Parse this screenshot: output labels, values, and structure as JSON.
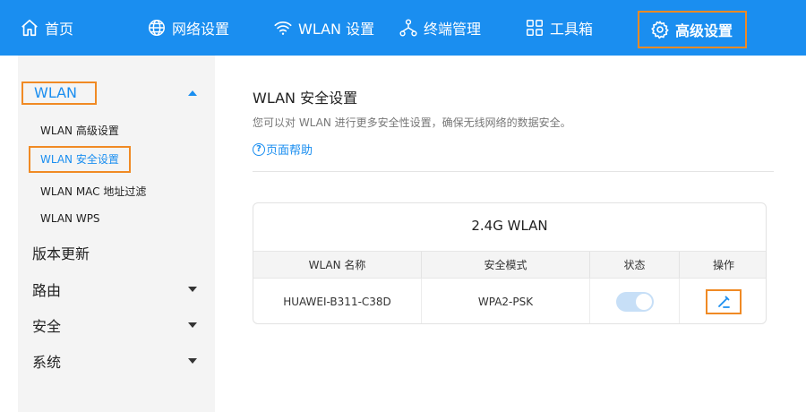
{
  "nav": {
    "home": "首页",
    "network": "网络设置",
    "wlan": "WLAN 设置",
    "devices": "终端管理",
    "toolbox": "工具箱",
    "advanced": "高级设置"
  },
  "sidebar": {
    "wlan_group": "WLAN",
    "wlan_items": [
      "WLAN 高级设置",
      "WLAN 安全设置",
      "WLAN MAC 地址过滤",
      "WLAN WPS"
    ],
    "groups": [
      "版本更新",
      "路由",
      "安全",
      "系统"
    ]
  },
  "main": {
    "title": "WLAN 安全设置",
    "description": "您可以对 WLAN 进行更多安全性设置，确保无线网络的数据安全。",
    "help": "页面帮助",
    "card": {
      "title": "2.4G WLAN",
      "columns": [
        "WLAN 名称",
        "安全模式",
        "状态",
        "操作"
      ],
      "rows": [
        {
          "name": "HUAWEI-B311-C38D",
          "security": "WPA2-PSK",
          "enabled": true
        }
      ]
    }
  },
  "colors": {
    "brand_blue": "#1a8ef0",
    "highlight_orange": "#f08a24",
    "toggle_on": "#c7dff7"
  },
  "icons": [
    "home-icon",
    "globe-icon",
    "wifi-icon",
    "network-tree-icon",
    "toolbox-icon",
    "gear-icon",
    "help-icon",
    "edit-icon",
    "chevron-up-icon",
    "chevron-down-icon"
  ]
}
